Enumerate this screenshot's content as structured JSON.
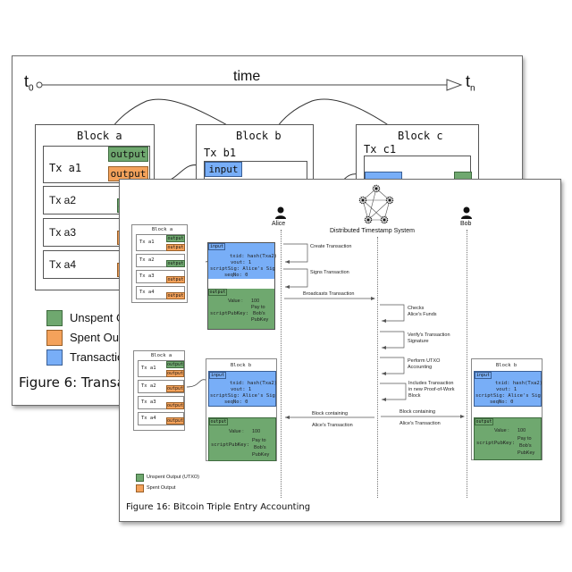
{
  "back_figure": {
    "caption": "Figure 6: Transact",
    "timeline": {
      "start": "t",
      "start_sub": "0",
      "label": "time",
      "end": "t",
      "end_sub": "n"
    },
    "blocks": [
      {
        "title": "Block a",
        "txs": [
          {
            "name": "Tx a1",
            "tags": [
              {
                "text": "output",
                "kind": "unspent"
              },
              {
                "text": "output",
                "kind": "spent"
              }
            ]
          },
          {
            "name": "Tx a2",
            "tags": [
              {
                "text": "out",
                "kind": "unspent"
              }
            ]
          },
          {
            "name": "Tx a3",
            "tags": [
              {
                "text": "ou",
                "kind": "spent"
              }
            ]
          },
          {
            "name": "Tx a4",
            "tags": [
              {
                "text": "out",
                "kind": "spent"
              }
            ]
          }
        ]
      },
      {
        "title": "Block b",
        "txs": [
          {
            "name": "Tx b1",
            "tags": [
              {
                "text": "input",
                "kind": "input"
              }
            ]
          }
        ]
      },
      {
        "title": "Block c",
        "txs": [
          {
            "name": "Tx c1",
            "tags": []
          }
        ]
      }
    ],
    "legend": [
      {
        "label": "Unspent O",
        "color": "#6fa86f"
      },
      {
        "label": "Spent Outp",
        "color": "#f4a25b"
      },
      {
        "label": "Transaction",
        "color": "#78aef7"
      }
    ]
  },
  "front_figure": {
    "caption": "Figure 16: Bitcoin Triple Entry Accounting",
    "actors": {
      "alice": "Alice",
      "dts": "Distributed Timestamp System",
      "bob": "Bob"
    },
    "block_a": {
      "title": "Block a",
      "txs": [
        {
          "name": "Tx a1",
          "tags": [
            "output",
            "output"
          ]
        },
        {
          "name": "Tx a2",
          "tags": [
            "output"
          ]
        },
        {
          "name": "Tx a3",
          "tags": [
            "output"
          ]
        },
        {
          "name": "Tx a4",
          "tags": [
            "output"
          ]
        }
      ]
    },
    "tx_detail": {
      "input_label": "input",
      "txid": "txid: hash(Txa2)",
      "vout": "vout: 1",
      "scriptSig": "scriptSig: Alice's Sig",
      "seqNo": "seqNo: 0",
      "output_label": "output",
      "value_key": "Value :",
      "value": "100",
      "pubkey_key": "scriptPubKey:",
      "pubkey_l1": "Pay to",
      "pubkey_l2": "Bob's",
      "pubkey_l3": "PubKey"
    },
    "block_b_title": "Block b",
    "messages": {
      "create": "Create Transaction",
      "sign": "Signs Transaction",
      "broadcast": "Broadcasts Transaction",
      "checks_1": "Checks",
      "checks_2": "Alice's Funds",
      "verify_1": "Verify's Transaction",
      "verify_2": "Signature",
      "utxo_1": "Perform UTXO",
      "utxo_2": "Accounting",
      "include_1": "Includes Transaction",
      "include_2": "in new Proof-of-Work",
      "include_3": "Block",
      "block_to_alice_1": "Block containing",
      "block_to_alice_2": "Alice's Transaction",
      "block_to_bob_1": "Block containing",
      "block_to_bob_2": "Alice's Transaction"
    },
    "legend": [
      {
        "label": "Unspent Output (UTXO)",
        "color": "#6fa86f"
      },
      {
        "label": "Spent Output",
        "color": "#f4a25b"
      }
    ]
  }
}
